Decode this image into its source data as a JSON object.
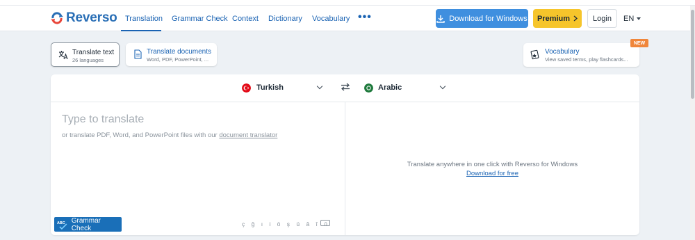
{
  "brand": {
    "name": "Reverso",
    "color": "#2a6fb6"
  },
  "nav": {
    "items": [
      {
        "label": "Translation",
        "active": true
      },
      {
        "label": "Grammar Check"
      },
      {
        "label": "Context"
      },
      {
        "label": "Dictionary"
      },
      {
        "label": "Vocabulary"
      }
    ],
    "more_icon": "more-dots-icon"
  },
  "header": {
    "download_label": "Download for Windows",
    "premium_label": "Premium",
    "login_label": "Login",
    "ui_language": "EN"
  },
  "modes": {
    "text": {
      "title": "Translate text",
      "subtitle": "26 languages"
    },
    "documents": {
      "title": "Translate documents",
      "subtitle": "Word, PDF, PowerPoint, ..."
    },
    "vocabulary": {
      "title": "Vocabulary",
      "subtitle": "View saved terms, play flashcards...",
      "badge": "NEW"
    }
  },
  "translator": {
    "source_language": "Turkish",
    "target_language": "Arabic",
    "placeholder": "Type to translate",
    "hint_prefix": "or translate PDF, Word, and PowerPoint files with our ",
    "hint_link": "document translator",
    "grammar_check_label": "Grammar Check",
    "special_characters": "ç ğ ı i ö ş ü â î û",
    "promo_text": "Translate anywhere in one click with Reverso for Windows",
    "promo_link": "Download for free"
  },
  "colors": {
    "accent": "#1a63b3",
    "download_button": "#3f8fdf",
    "premium_button": "#f6c52b",
    "new_badge": "#f0863a",
    "grammar_button": "#1a6fb8"
  }
}
